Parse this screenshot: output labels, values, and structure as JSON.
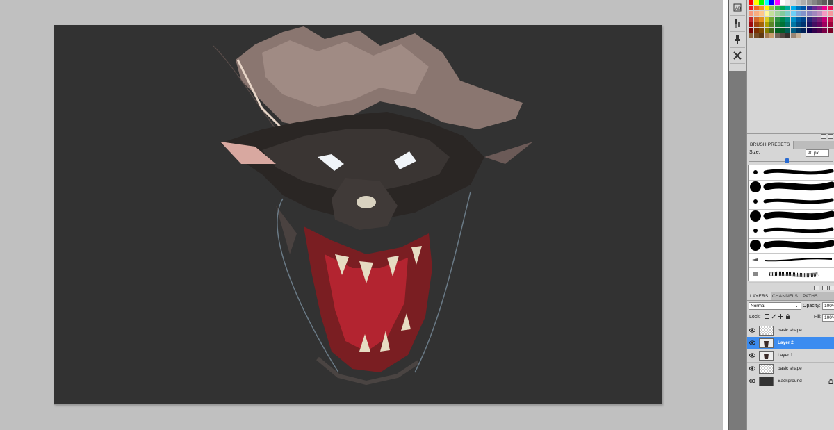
{
  "colors": {
    "workspace": "#c0c0c0",
    "canvas": "#323232",
    "panel": "#d6d6d6",
    "selected_layer": "#3c8cf0"
  },
  "dock_icons": [
    {
      "name": "history-panel-icon"
    },
    {
      "name": "brush-tool-panel-icon"
    },
    {
      "name": "clone-source-panel-icon"
    },
    {
      "name": "tool-presets-panel-icon"
    }
  ],
  "swatches": {
    "colors_row1": [
      "#ff0000",
      "#ffff00",
      "#00ff00",
      "#00ffff",
      "#0000ff",
      "#ff00ff",
      "#ffffff",
      "#ebebeb",
      "#d6d6d6",
      "#c2c2c2",
      "#adadad",
      "#999999",
      "#858585",
      "#707070",
      "#5c5c5c",
      "#474747"
    ],
    "colors_row2": [
      "#ed1c24",
      "#f26522",
      "#f7941d",
      "#fff200",
      "#8dc63f",
      "#39b54a",
      "#00a651",
      "#00a99d",
      "#00aeef",
      "#0072bc",
      "#0054a6",
      "#2e3192",
      "#662d91",
      "#92278f",
      "#ec008c",
      "#ed145b"
    ],
    "colors_row3": [
      "#f7977a",
      "#f9ad81",
      "#fdc68a",
      "#fff79a",
      "#c4df9b",
      "#a3d39c",
      "#82ca9d",
      "#7bcdc8",
      "#6ecff6",
      "#7ea7d8",
      "#8493ca",
      "#8882be",
      "#a187be",
      "#bc8dbf",
      "#f49ac2",
      "#f6989d"
    ],
    "colors_row4": [
      "#c1272d",
      "#d4692b",
      "#e3901d",
      "#d9cc1f",
      "#72a834",
      "#2e9142",
      "#00854a",
      "#008b82",
      "#008fc5",
      "#005ba0",
      "#00458a",
      "#252878",
      "#522478",
      "#771f74",
      "#c20072",
      "#c2124b"
    ],
    "colors_row5": [
      "#9e0b0f",
      "#a0410d",
      "#a3620a",
      "#aba000",
      "#598527",
      "#197b30",
      "#007236",
      "#00746b",
      "#0076a3",
      "#004b80",
      "#003471",
      "#1b1464",
      "#440e62",
      "#630460",
      "#9e005d",
      "#9e0039"
    ],
    "colors_row6": [
      "#790000",
      "#7b2e00",
      "#7d4900",
      "#827b00",
      "#406618",
      "#005e20",
      "#005826",
      "#005952",
      "#005b7f",
      "#003663",
      "#002157",
      "#0d004c",
      "#32004b",
      "#4b0049",
      "#7b0046",
      "#7a0026"
    ],
    "colors_row7": [
      "#8c6239",
      "#754c24",
      "#603913",
      "#a67c52",
      "#c69c6d",
      "#736357",
      "#534741",
      "#362f2d",
      "#998675",
      "#c7b299"
    ]
  },
  "brush_presets": {
    "tab_label": "BRUSH PRESETS",
    "size_label": "Size:",
    "size_value": "90 px",
    "size_fraction": 0.45,
    "rows": [
      {
        "kind": "soft-small"
      },
      {
        "kind": "hard-large"
      },
      {
        "kind": "soft-small"
      },
      {
        "kind": "hard-large"
      },
      {
        "kind": "soft-small"
      },
      {
        "kind": "hard-large"
      },
      {
        "kind": "ink-pen"
      },
      {
        "kind": "dry-brush"
      }
    ]
  },
  "layers_panel": {
    "tabs": [
      "LAYERS",
      "CHANNELS",
      "PATHS"
    ],
    "blend_mode": "Normal",
    "opacity_label": "Opacity:",
    "opacity_value": "100%",
    "lock_label": "Lock:",
    "fill_label": "Fill:",
    "fill_value": "100%",
    "layers": [
      {
        "name": "basic shape",
        "thumb": "checker",
        "selected": false
      },
      {
        "name": "Layer 2",
        "thumb": "sketch",
        "selected": true
      },
      {
        "name": "Layer 1",
        "thumb": "sketch",
        "selected": false
      },
      {
        "name": "basic shape",
        "thumb": "checker",
        "selected": false
      },
      {
        "name": "Background",
        "thumb": "solid",
        "selected": false,
        "locked": true
      }
    ]
  }
}
